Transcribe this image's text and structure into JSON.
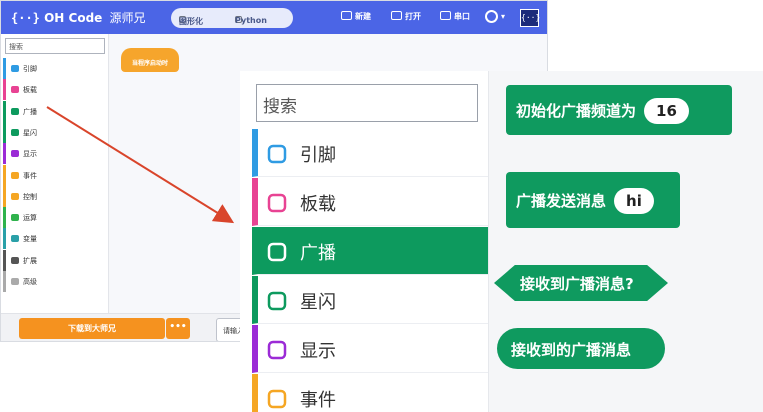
{
  "app": {
    "brand": "OH Code",
    "brand_sub": "源师兄",
    "mode_blocks": "图形化",
    "mode_python": "Python",
    "btn_new": "新建",
    "btn_open": "打开",
    "btn_serial": "串口",
    "avatar": "{··}"
  },
  "mini": {
    "search_placeholder": "搜索",
    "categories": [
      {
        "label": "引脚",
        "color": "#2f9be3"
      },
      {
        "label": "板载",
        "color": "#e84393"
      },
      {
        "label": "广播",
        "color": "#0d9a5e"
      },
      {
        "label": "星闪",
        "color": "#0d9a5e"
      },
      {
        "label": "显示",
        "color": "#9b2bd6"
      },
      {
        "label": "事件",
        "color": "#f5a623"
      },
      {
        "label": "控制",
        "color": "#f5a623"
      },
      {
        "label": "运算",
        "color": "#2fb24c"
      },
      {
        "label": "变量",
        "color": "#2aa0a8"
      },
      {
        "label": "扩展",
        "color": "#555555"
      },
      {
        "label": "高级",
        "color": "#aaaaaa"
      }
    ],
    "hat_block": "当程序启动时",
    "upload_button": "下载到大师兄",
    "more_button": "•••",
    "input_placeholder": "请输入项"
  },
  "zoom": {
    "search_placeholder": "搜索",
    "categories": [
      {
        "label": "引脚",
        "color": "#2f9be3",
        "icon": "pin-icon"
      },
      {
        "label": "板载",
        "color": "#e84393",
        "icon": "onboard-icon"
      },
      {
        "label": "广播",
        "color": "#0d9a5e",
        "icon": "broadcast-icon",
        "active": true
      },
      {
        "label": "星闪",
        "color": "#0d9a5e",
        "icon": "network-icon"
      },
      {
        "label": "显示",
        "color": "#9b2bd6",
        "icon": "display-icon"
      },
      {
        "label": "事件",
        "color": "#f5a623",
        "icon": "event-icon"
      }
    ],
    "blocks": {
      "init_label": "初始化广播频道为",
      "init_value": "16",
      "send_label": "广播发送消息",
      "send_value": "hi",
      "received_bool": "接收到广播消息?",
      "received_msg": "接收到的广播消息"
    }
  }
}
